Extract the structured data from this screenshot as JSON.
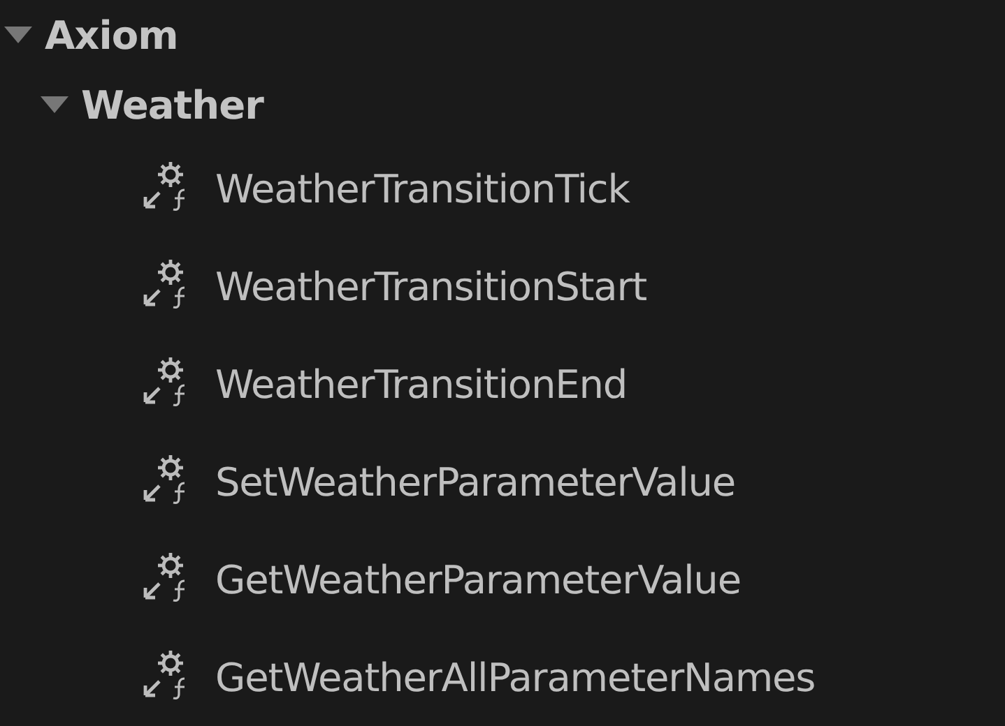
{
  "tree": [
    {
      "label": "Axiom",
      "expanded": true,
      "children": [
        {
          "label": "Weather",
          "expanded": true,
          "children": [
            {
              "label": "WeatherTransitionTick",
              "kind": "function"
            },
            {
              "label": "WeatherTransitionStart",
              "kind": "function"
            },
            {
              "label": "WeatherTransitionEnd",
              "kind": "function"
            },
            {
              "label": "SetWeatherParameterValue",
              "kind": "function"
            },
            {
              "label": "GetWeatherParameterValue",
              "kind": "function"
            },
            {
              "label": "GetWeatherAllParameterNames",
              "kind": "function"
            }
          ]
        }
      ]
    }
  ]
}
